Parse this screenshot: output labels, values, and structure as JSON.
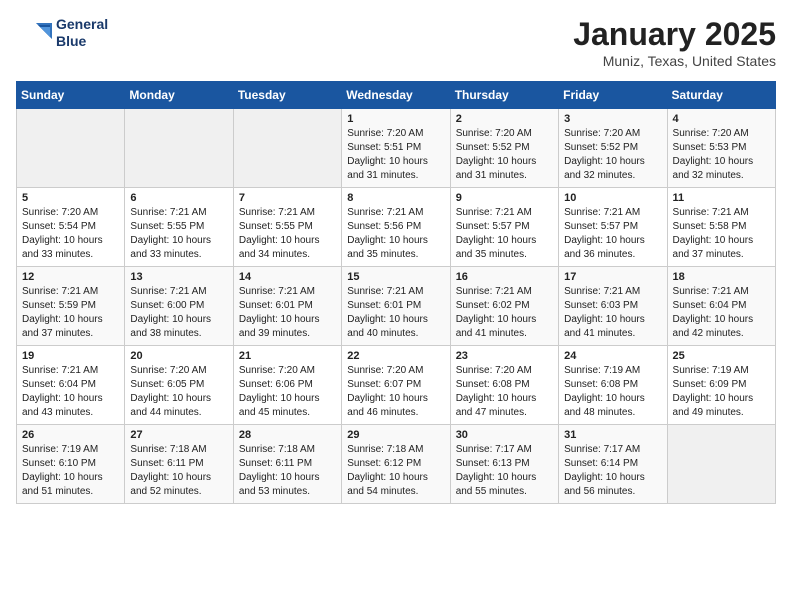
{
  "header": {
    "logo_line1": "General",
    "logo_line2": "Blue",
    "title": "January 2025",
    "location": "Muniz, Texas, United States"
  },
  "weekdays": [
    "Sunday",
    "Monday",
    "Tuesday",
    "Wednesday",
    "Thursday",
    "Friday",
    "Saturday"
  ],
  "weeks": [
    [
      {
        "day": "",
        "sunrise": "",
        "sunset": "",
        "daylight": ""
      },
      {
        "day": "",
        "sunrise": "",
        "sunset": "",
        "daylight": ""
      },
      {
        "day": "",
        "sunrise": "",
        "sunset": "",
        "daylight": ""
      },
      {
        "day": "1",
        "sunrise": "Sunrise: 7:20 AM",
        "sunset": "Sunset: 5:51 PM",
        "daylight": "Daylight: 10 hours and 31 minutes."
      },
      {
        "day": "2",
        "sunrise": "Sunrise: 7:20 AM",
        "sunset": "Sunset: 5:52 PM",
        "daylight": "Daylight: 10 hours and 31 minutes."
      },
      {
        "day": "3",
        "sunrise": "Sunrise: 7:20 AM",
        "sunset": "Sunset: 5:52 PM",
        "daylight": "Daylight: 10 hours and 32 minutes."
      },
      {
        "day": "4",
        "sunrise": "Sunrise: 7:20 AM",
        "sunset": "Sunset: 5:53 PM",
        "daylight": "Daylight: 10 hours and 32 minutes."
      }
    ],
    [
      {
        "day": "5",
        "sunrise": "Sunrise: 7:20 AM",
        "sunset": "Sunset: 5:54 PM",
        "daylight": "Daylight: 10 hours and 33 minutes."
      },
      {
        "day": "6",
        "sunrise": "Sunrise: 7:21 AM",
        "sunset": "Sunset: 5:55 PM",
        "daylight": "Daylight: 10 hours and 33 minutes."
      },
      {
        "day": "7",
        "sunrise": "Sunrise: 7:21 AM",
        "sunset": "Sunset: 5:55 PM",
        "daylight": "Daylight: 10 hours and 34 minutes."
      },
      {
        "day": "8",
        "sunrise": "Sunrise: 7:21 AM",
        "sunset": "Sunset: 5:56 PM",
        "daylight": "Daylight: 10 hours and 35 minutes."
      },
      {
        "day": "9",
        "sunrise": "Sunrise: 7:21 AM",
        "sunset": "Sunset: 5:57 PM",
        "daylight": "Daylight: 10 hours and 35 minutes."
      },
      {
        "day": "10",
        "sunrise": "Sunrise: 7:21 AM",
        "sunset": "Sunset: 5:57 PM",
        "daylight": "Daylight: 10 hours and 36 minutes."
      },
      {
        "day": "11",
        "sunrise": "Sunrise: 7:21 AM",
        "sunset": "Sunset: 5:58 PM",
        "daylight": "Daylight: 10 hours and 37 minutes."
      }
    ],
    [
      {
        "day": "12",
        "sunrise": "Sunrise: 7:21 AM",
        "sunset": "Sunset: 5:59 PM",
        "daylight": "Daylight: 10 hours and 37 minutes."
      },
      {
        "day": "13",
        "sunrise": "Sunrise: 7:21 AM",
        "sunset": "Sunset: 6:00 PM",
        "daylight": "Daylight: 10 hours and 38 minutes."
      },
      {
        "day": "14",
        "sunrise": "Sunrise: 7:21 AM",
        "sunset": "Sunset: 6:01 PM",
        "daylight": "Daylight: 10 hours and 39 minutes."
      },
      {
        "day": "15",
        "sunrise": "Sunrise: 7:21 AM",
        "sunset": "Sunset: 6:01 PM",
        "daylight": "Daylight: 10 hours and 40 minutes."
      },
      {
        "day": "16",
        "sunrise": "Sunrise: 7:21 AM",
        "sunset": "Sunset: 6:02 PM",
        "daylight": "Daylight: 10 hours and 41 minutes."
      },
      {
        "day": "17",
        "sunrise": "Sunrise: 7:21 AM",
        "sunset": "Sunset: 6:03 PM",
        "daylight": "Daylight: 10 hours and 41 minutes."
      },
      {
        "day": "18",
        "sunrise": "Sunrise: 7:21 AM",
        "sunset": "Sunset: 6:04 PM",
        "daylight": "Daylight: 10 hours and 42 minutes."
      }
    ],
    [
      {
        "day": "19",
        "sunrise": "Sunrise: 7:21 AM",
        "sunset": "Sunset: 6:04 PM",
        "daylight": "Daylight: 10 hours and 43 minutes."
      },
      {
        "day": "20",
        "sunrise": "Sunrise: 7:20 AM",
        "sunset": "Sunset: 6:05 PM",
        "daylight": "Daylight: 10 hours and 44 minutes."
      },
      {
        "day": "21",
        "sunrise": "Sunrise: 7:20 AM",
        "sunset": "Sunset: 6:06 PM",
        "daylight": "Daylight: 10 hours and 45 minutes."
      },
      {
        "day": "22",
        "sunrise": "Sunrise: 7:20 AM",
        "sunset": "Sunset: 6:07 PM",
        "daylight": "Daylight: 10 hours and 46 minutes."
      },
      {
        "day": "23",
        "sunrise": "Sunrise: 7:20 AM",
        "sunset": "Sunset: 6:08 PM",
        "daylight": "Daylight: 10 hours and 47 minutes."
      },
      {
        "day": "24",
        "sunrise": "Sunrise: 7:19 AM",
        "sunset": "Sunset: 6:08 PM",
        "daylight": "Daylight: 10 hours and 48 minutes."
      },
      {
        "day": "25",
        "sunrise": "Sunrise: 7:19 AM",
        "sunset": "Sunset: 6:09 PM",
        "daylight": "Daylight: 10 hours and 49 minutes."
      }
    ],
    [
      {
        "day": "26",
        "sunrise": "Sunrise: 7:19 AM",
        "sunset": "Sunset: 6:10 PM",
        "daylight": "Daylight: 10 hours and 51 minutes."
      },
      {
        "day": "27",
        "sunrise": "Sunrise: 7:18 AM",
        "sunset": "Sunset: 6:11 PM",
        "daylight": "Daylight: 10 hours and 52 minutes."
      },
      {
        "day": "28",
        "sunrise": "Sunrise: 7:18 AM",
        "sunset": "Sunset: 6:11 PM",
        "daylight": "Daylight: 10 hours and 53 minutes."
      },
      {
        "day": "29",
        "sunrise": "Sunrise: 7:18 AM",
        "sunset": "Sunset: 6:12 PM",
        "daylight": "Daylight: 10 hours and 54 minutes."
      },
      {
        "day": "30",
        "sunrise": "Sunrise: 7:17 AM",
        "sunset": "Sunset: 6:13 PM",
        "daylight": "Daylight: 10 hours and 55 minutes."
      },
      {
        "day": "31",
        "sunrise": "Sunrise: 7:17 AM",
        "sunset": "Sunset: 6:14 PM",
        "daylight": "Daylight: 10 hours and 56 minutes."
      },
      {
        "day": "",
        "sunrise": "",
        "sunset": "",
        "daylight": ""
      }
    ]
  ]
}
